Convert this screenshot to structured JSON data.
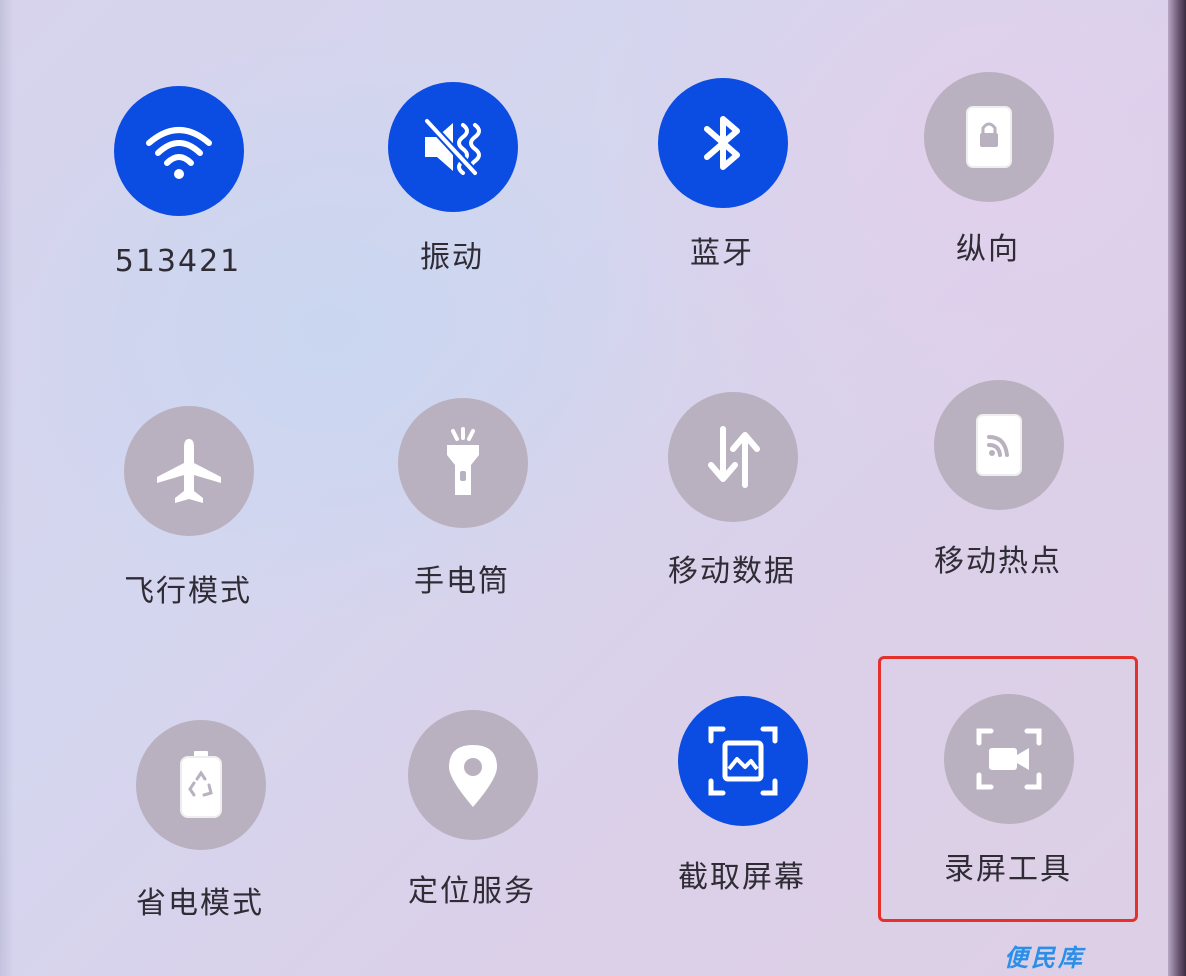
{
  "quick_settings": {
    "tiles": [
      {
        "label": "513421",
        "icon": "wifi-icon",
        "state": "on"
      },
      {
        "label": "振动",
        "icon": "vibrate-icon",
        "state": "on"
      },
      {
        "label": "蓝牙",
        "icon": "bluetooth-icon",
        "state": "on"
      },
      {
        "label": "纵向",
        "icon": "portrait-lock-icon",
        "state": "off"
      },
      {
        "label": "飞行模式",
        "icon": "airplane-icon",
        "state": "off"
      },
      {
        "label": "手电筒",
        "icon": "flashlight-icon",
        "state": "off"
      },
      {
        "label": "移动数据",
        "icon": "mobile-data-icon",
        "state": "off"
      },
      {
        "label": "移动热点",
        "icon": "hotspot-icon",
        "state": "off"
      },
      {
        "label": "省电模式",
        "icon": "battery-saver-icon",
        "state": "off"
      },
      {
        "label": "定位服务",
        "icon": "location-pin-icon",
        "state": "off"
      },
      {
        "label": "截取屏幕",
        "icon": "screenshot-icon",
        "state": "on"
      },
      {
        "label": "录屏工具",
        "icon": "screen-record-icon",
        "state": "off"
      }
    ],
    "highlighted_tile": "录屏工具"
  },
  "watermark": "便民库",
  "colors": {
    "active": "#0b4de3",
    "inactive": "#b9b1c0",
    "highlight": "#e5302b",
    "watermark": "#2a8fe8"
  }
}
